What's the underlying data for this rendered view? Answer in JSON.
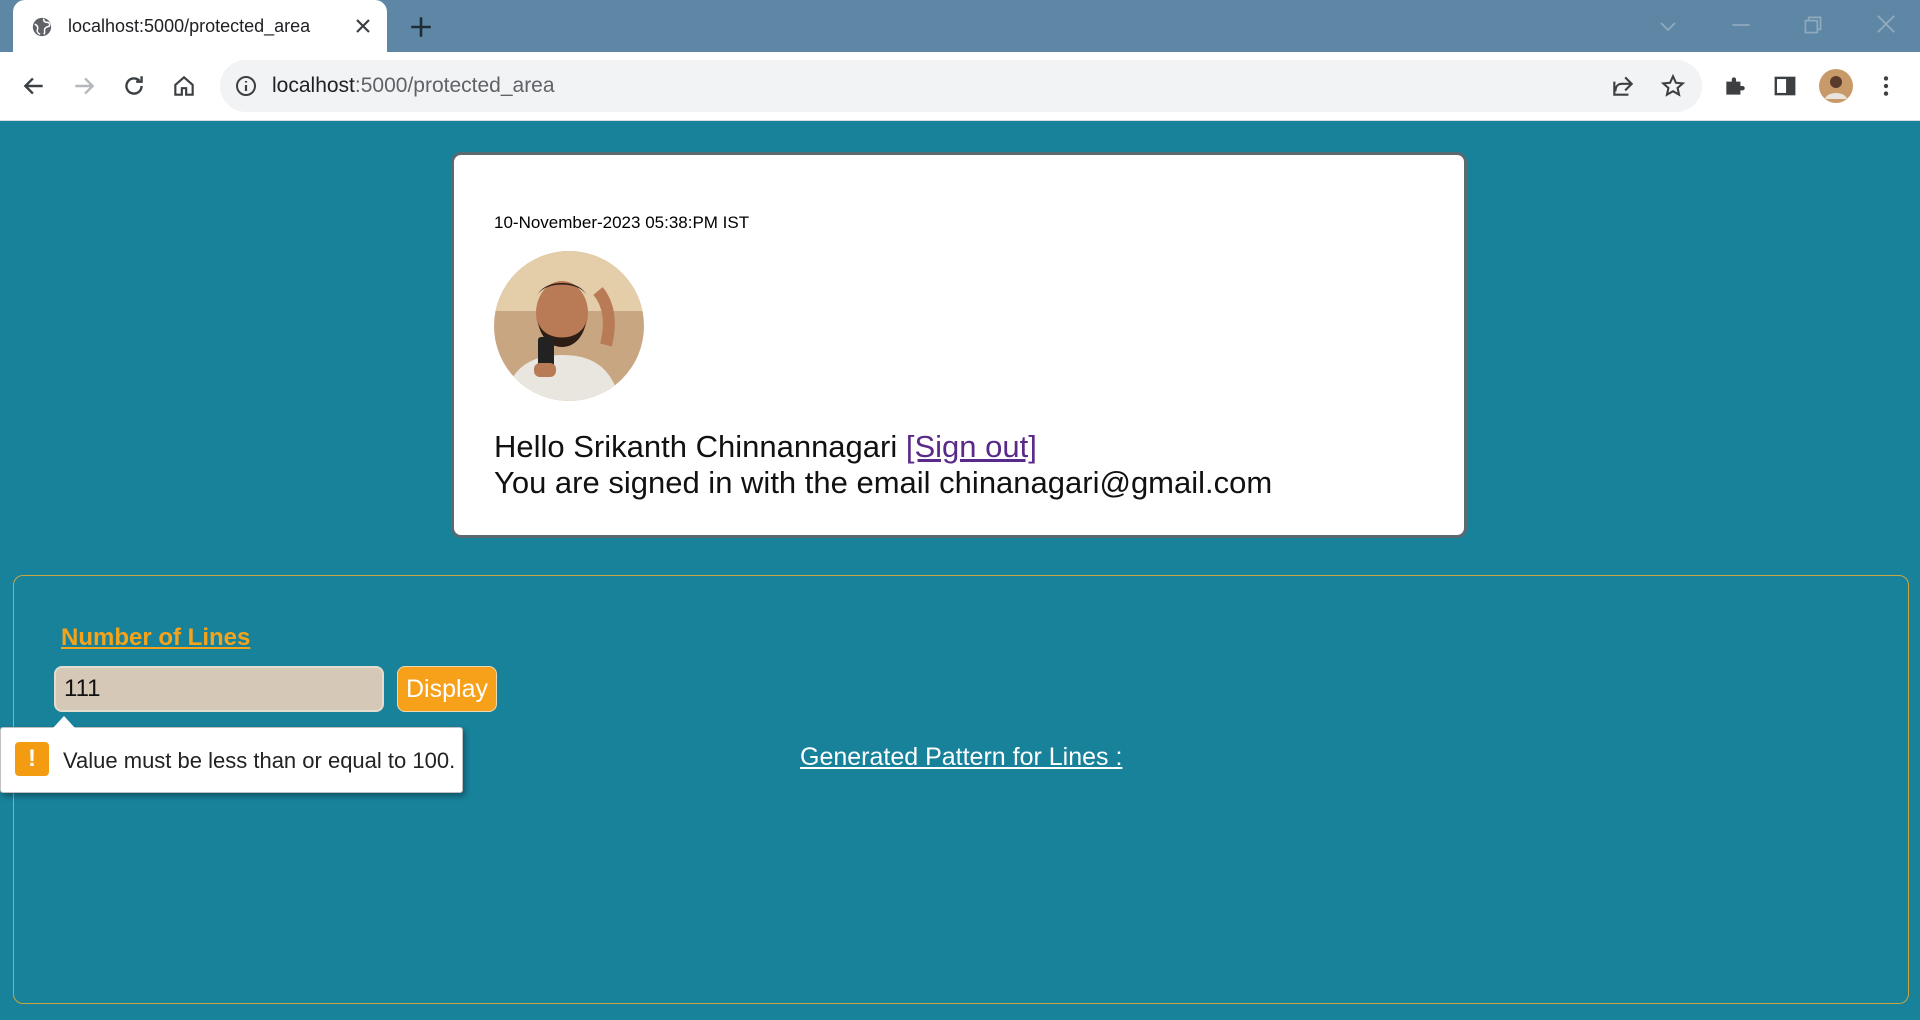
{
  "browser": {
    "tab_title": "localhost:5000/protected_area",
    "url_host": "localhost",
    "url_rest": ":5000/protected_area"
  },
  "card": {
    "timestamp": "10-November-2023 05:38:PM IST",
    "hello_prefix": "Hello Srikanth Chinnannagari ",
    "sign_out": "[Sign out]",
    "email_line": "You are signed in with the email chinanagari@gmail.com"
  },
  "form": {
    "label": "Number of Lines",
    "value": "111",
    "button": "Display",
    "validation": "Value must be less than or equal to 100."
  },
  "result": {
    "heading": "Generated Pattern for Lines :"
  },
  "colors": {
    "page_bg": "#18829b",
    "accent": "#f5a31a"
  }
}
